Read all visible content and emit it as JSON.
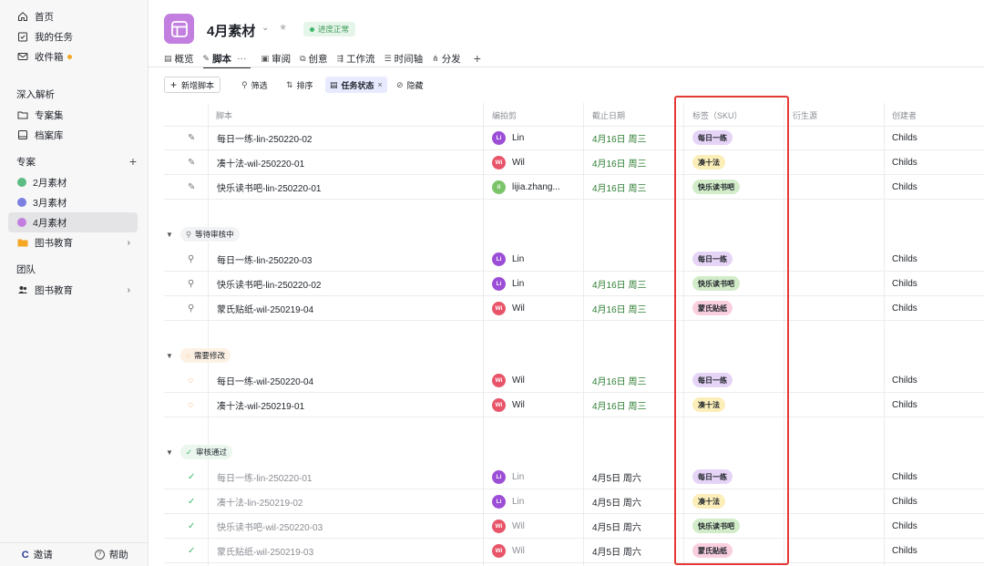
{
  "sidebar": {
    "home": "首页",
    "my_tasks": "我的任务",
    "inbox": "收件箱",
    "section_analysis": "深入解析",
    "collections": "专案集",
    "archive": "档案库",
    "section_projects": "专案",
    "projects": [
      {
        "label": "2月素材",
        "color": "#5dbb84"
      },
      {
        "label": "3月素材",
        "color": "#7b7fe0"
      },
      {
        "label": "4月素材",
        "color": "#c27fe0"
      },
      {
        "label": "图书教育",
        "color": "#f5a623"
      }
    ],
    "section_team": "团队",
    "team": "图书教育",
    "invite": "邀请",
    "help": "帮助"
  },
  "header": {
    "title": "4月素材",
    "status": "进度正常",
    "tabs": [
      {
        "label": "概览"
      },
      {
        "label": "脚本"
      },
      {
        "label": "审阅"
      },
      {
        "label": "创意"
      },
      {
        "label": "工作流"
      },
      {
        "label": "时间轴"
      },
      {
        "label": "分发"
      }
    ]
  },
  "toolbar": {
    "new_script": "新增脚本",
    "filter": "筛选",
    "sort": "排序",
    "task_status": "任务状态",
    "hide": "隐藏"
  },
  "columns": {
    "script": "脚本",
    "editor": "编拍剪",
    "due": "截止日期",
    "tags": "标签（SKU）",
    "derived": "衍生源",
    "creator": "创建者"
  },
  "groups": {
    "pending": "等待审核中",
    "revise": "需要修改",
    "approved": "审核通过"
  },
  "rows": [
    {
      "name": "每日一练-lin-250220-02",
      "av": "Li",
      "avc": "#9c4fd6",
      "editor": "Lin",
      "due": "4月16日 周三",
      "tag": "每日一练",
      "tagc": "#e6d4f7",
      "creator": "Childs"
    },
    {
      "name": "凑十法-wil-250220-01",
      "av": "Wi",
      "avc": "#e8556a",
      "editor": "Wil",
      "due": "4月16日 周三",
      "tag": "凑十法",
      "tagc": "#fbeeb8",
      "creator": "Childs"
    },
    {
      "name": "快乐读书吧-lin-250220-01",
      "av": "li",
      "avc": "#7cc46a",
      "editor": "lijia.zhang...",
      "due": "4月16日 周三",
      "tag": "快乐读书吧",
      "tagc": "#d2ecc9",
      "creator": "Childs"
    },
    {
      "name": "每日一练-lin-250220-03",
      "av": "Li",
      "avc": "#9c4fd6",
      "editor": "Lin",
      "due": "",
      "tag": "每日一练",
      "tagc": "#e6d4f7",
      "creator": "Childs"
    },
    {
      "name": "快乐读书吧-lin-250220-02",
      "av": "Li",
      "avc": "#9c4fd6",
      "editor": "Lin",
      "due": "4月16日 周三",
      "tag": "快乐读书吧",
      "tagc": "#d2ecc9",
      "creator": "Childs"
    },
    {
      "name": "蒙氏贴纸-wil-250219-04",
      "av": "Wi",
      "avc": "#e8556a",
      "editor": "Wil",
      "due": "4月16日 周三",
      "tag": "蒙氏贴纸",
      "tagc": "#f9cfe0",
      "creator": "Childs"
    },
    {
      "name": "每日一练-wil-250220-04",
      "av": "Wi",
      "avc": "#e8556a",
      "editor": "Wil",
      "due": "4月16日 周三",
      "tag": "每日一练",
      "tagc": "#e6d4f7",
      "creator": "Childs"
    },
    {
      "name": "凑十法-wil-250219-01",
      "av": "Wi",
      "avc": "#e8556a",
      "editor": "Wil",
      "due": "4月16日 周三",
      "tag": "凑十法",
      "tagc": "#fbeeb8",
      "creator": "Childs"
    },
    {
      "name": "每日一练-lin-250220-01",
      "av": "Li",
      "avc": "#9c4fd6",
      "editor": "Lin",
      "due": "4月5日 周六",
      "tag": "每日一练",
      "tagc": "#e6d4f7",
      "creator": "Childs"
    },
    {
      "name": "凑十法-lin-250219-02",
      "av": "Li",
      "avc": "#9c4fd6",
      "editor": "Lin",
      "due": "4月5日 周六",
      "tag": "凑十法",
      "tagc": "#fbeeb8",
      "creator": "Childs"
    },
    {
      "name": "快乐读书吧-wil-250220-03",
      "av": "Wi",
      "avc": "#e8556a",
      "editor": "Wil",
      "due": "4月5日 周六",
      "tag": "快乐读书吧",
      "tagc": "#d2ecc9",
      "creator": "Childs"
    },
    {
      "name": "蒙氏贴纸-wil-250219-03",
      "av": "Wi",
      "avc": "#e8556a",
      "editor": "Wil",
      "due": "4月5日 周六",
      "tag": "蒙氏贴纸",
      "tagc": "#f9cfe0",
      "creator": "Childs"
    }
  ]
}
